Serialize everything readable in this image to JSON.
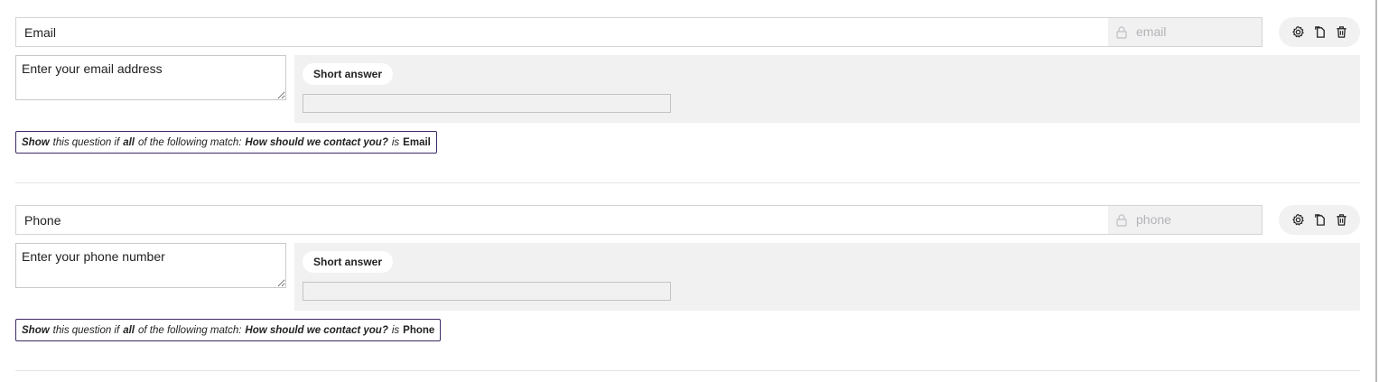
{
  "questions": [
    {
      "title": "Email",
      "key": "email",
      "description": "Enter your email address",
      "answer_type": "Short answer",
      "condition": {
        "verb": "Show",
        "text1": "this question if",
        "quantifier": "all",
        "text2": "of the following match:",
        "field": "How should we contact you?",
        "operator": "is",
        "value": "Email"
      }
    },
    {
      "title": "Phone",
      "key": "phone",
      "description": "Enter your phone number",
      "answer_type": "Short answer",
      "condition": {
        "verb": "Show",
        "text1": "this question if",
        "quantifier": "all",
        "text2": "of the following match:",
        "field": "How should we contact you?",
        "operator": "is",
        "value": "Phone"
      }
    }
  ],
  "icons": {
    "settings": "gear-icon",
    "duplicate": "copy-icon",
    "delete": "trash-icon",
    "lock": "lock-icon"
  },
  "colors": {
    "panel_bg": "#f1f1f2",
    "condition_border": "#3d2a66",
    "key_text": "#b4b4b8"
  }
}
